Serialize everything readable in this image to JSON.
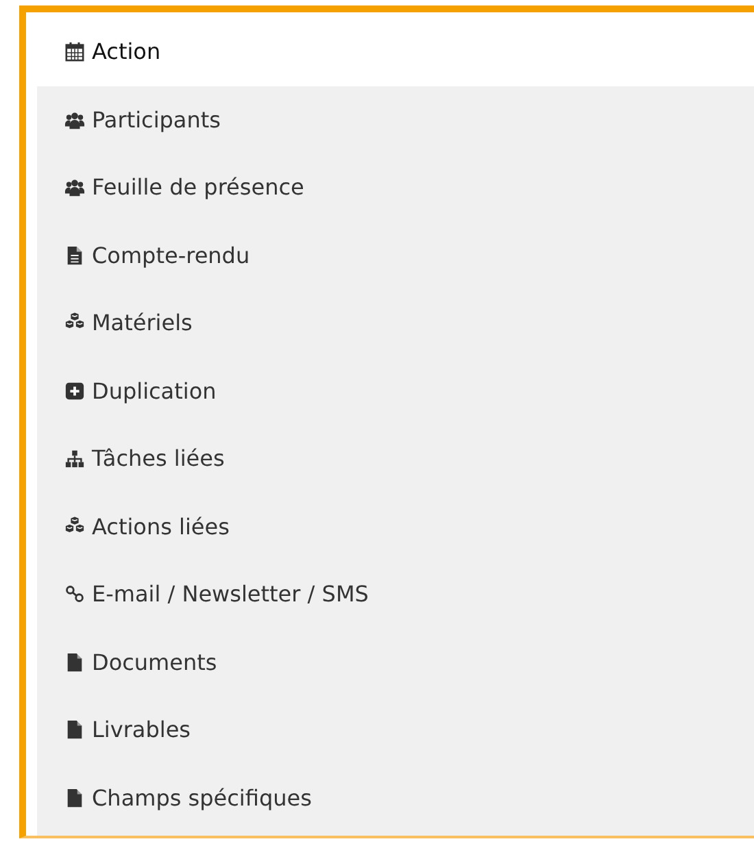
{
  "menu": {
    "items": [
      {
        "label": "Action",
        "kind": "calendar",
        "selected": true
      },
      {
        "label": "Participants",
        "kind": "users",
        "selected": false
      },
      {
        "label": "Feuille de présence",
        "kind": "users",
        "selected": false
      },
      {
        "label": "Compte-rendu",
        "kind": "report",
        "selected": false
      },
      {
        "label": "Matériels",
        "kind": "cubes",
        "selected": false
      },
      {
        "label": "Duplication",
        "kind": "duplicate",
        "selected": false
      },
      {
        "label": "Tâches liées",
        "kind": "hierarchy",
        "selected": false
      },
      {
        "label": "Actions liées",
        "kind": "cubes",
        "selected": false
      },
      {
        "label": "E-mail / Newsletter / SMS",
        "kind": "link",
        "selected": false
      },
      {
        "label": "Documents",
        "kind": "file",
        "selected": false
      },
      {
        "label": "Livrables",
        "kind": "file",
        "selected": false
      },
      {
        "label": "Champs spécifiques",
        "kind": "file",
        "selected": false
      }
    ]
  }
}
